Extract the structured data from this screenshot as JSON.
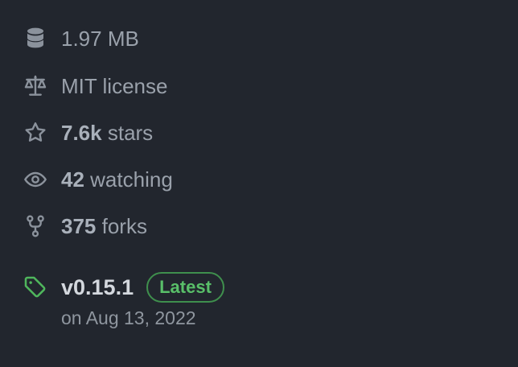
{
  "repo_meta": {
    "size": {
      "icon": "database-icon",
      "label": "1.97 MB"
    },
    "license": {
      "icon": "law-scale-icon",
      "label": "MIT license"
    },
    "stars": {
      "icon": "star-icon",
      "count": "7.6k",
      "suffix": "stars"
    },
    "watching": {
      "icon": "eye-icon",
      "count": "42",
      "suffix": "watching"
    },
    "forks": {
      "icon": "repo-forked-icon",
      "count": "375",
      "suffix": "forks"
    }
  },
  "release": {
    "icon": "tag-icon",
    "version": "v0.15.1",
    "badge": "Latest",
    "date": "on Aug 13, 2022"
  },
  "colors": {
    "background": "#22262e",
    "muted_text": "#9aa1ab",
    "accent_green": "#4fb65c"
  }
}
